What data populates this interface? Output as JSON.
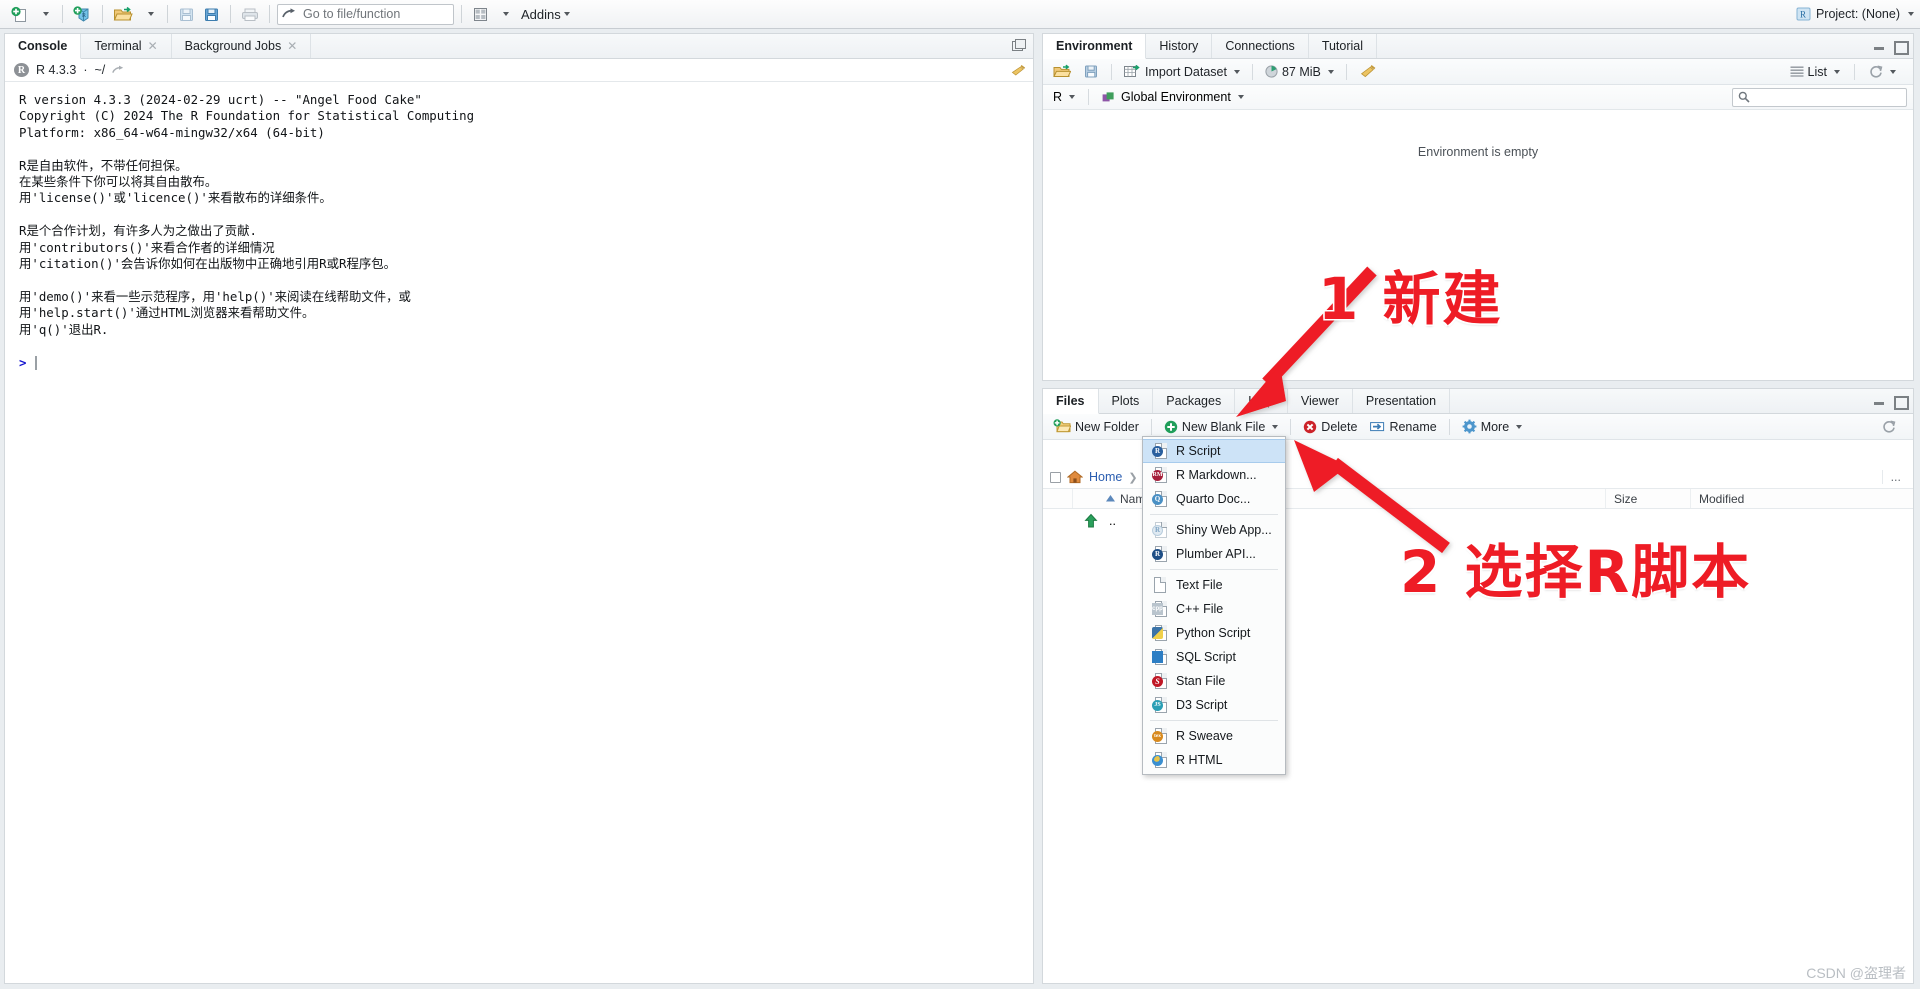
{
  "toolbar": {
    "new_file_label": "new-file",
    "new_project_label": "new-project",
    "open_file_label": "open-file",
    "save_label": "save",
    "save_all_label": "save-all",
    "print_label": "print",
    "goto_placeholder": "Go to file/function",
    "panes_label": "panes",
    "addins_label": "Addins",
    "project_label": "Project: (None)"
  },
  "console": {
    "tabs": [
      {
        "label": "Console",
        "closable": false,
        "active": true
      },
      {
        "label": "Terminal",
        "closable": true,
        "active": false
      },
      {
        "label": "Background Jobs",
        "closable": true,
        "active": false
      }
    ],
    "version_label": "R 4.3.3",
    "path_label": "~/",
    "separator": "·",
    "output": "R version 4.3.3 (2024-02-29 ucrt) -- \"Angel Food Cake\"\nCopyright (C) 2024 The R Foundation for Statistical Computing\nPlatform: x86_64-w64-mingw32/x64 (64-bit)\n\nR是自由软件，不带任何担保。\n在某些条件下你可以将其自由散布。\n用'license()'或'licence()'来看散布的详细条件。\n\nR是个合作计划，有许多人为之做出了贡献.\n用'contributors()'来看合作者的详细情况\n用'citation()'会告诉你如何在出版物中正确地引用R或R程序包。\n\n用'demo()'来看一些示范程序，用'help()'来阅读在线帮助文件，或\n用'help.start()'通过HTML浏览器来看帮助文件。\n用'q()'退出R.",
    "prompt": ">"
  },
  "environment": {
    "tabs": [
      {
        "label": "Environment",
        "active": true
      },
      {
        "label": "History",
        "active": false
      },
      {
        "label": "Connections",
        "active": false
      },
      {
        "label": "Tutorial",
        "active": false
      }
    ],
    "toolbar": {
      "load_label": "load-workspace",
      "save_label": "save-workspace",
      "import_label": "Import Dataset",
      "memory_label": "87 MiB",
      "clear_label": "clear-objects",
      "view_label": "List",
      "refresh_label": "refresh"
    },
    "language_label": "R",
    "scope_label": "Global Environment",
    "search_placeholder": "",
    "empty_message": "Environment is empty"
  },
  "files": {
    "tabs": [
      {
        "label": "Files",
        "active": true
      },
      {
        "label": "Plots",
        "active": false
      },
      {
        "label": "Packages",
        "active": false
      },
      {
        "label": "Help",
        "active": false
      },
      {
        "label": "Viewer",
        "active": false
      },
      {
        "label": "Presentation",
        "active": false
      }
    ],
    "toolbar": {
      "new_folder_label": "New Folder",
      "new_blank_file_label": "New Blank File",
      "delete_label": "Delete",
      "rename_label": "Rename",
      "more_label": "More",
      "refresh_label": "refresh"
    },
    "breadcrumb": [
      "Home"
    ],
    "more_button_label": "...",
    "columns": [
      "",
      "Name",
      "Size",
      "Modified"
    ],
    "rows": [
      {
        "name": "..",
        "size": "",
        "modified": ""
      }
    ]
  },
  "new_file_menu": {
    "items": [
      {
        "label": "R Script",
        "icon": "r-script-icon",
        "selected": true,
        "sep_after": false
      },
      {
        "label": "R Markdown...",
        "icon": "r-markdown-icon",
        "selected": false,
        "sep_after": false
      },
      {
        "label": "Quarto Doc...",
        "icon": "quarto-icon",
        "selected": false,
        "sep_after": true
      },
      {
        "label": "Shiny Web App...",
        "icon": "shiny-icon",
        "selected": false,
        "sep_after": false
      },
      {
        "label": "Plumber API...",
        "icon": "plumber-icon",
        "selected": false,
        "sep_after": true
      },
      {
        "label": "Text File",
        "icon": "text-file-icon",
        "selected": false,
        "sep_after": false
      },
      {
        "label": "C++ File",
        "icon": "cpp-file-icon",
        "selected": false,
        "sep_after": false
      },
      {
        "label": "Python Script",
        "icon": "python-icon",
        "selected": false,
        "sep_after": false
      },
      {
        "label": "SQL Script",
        "icon": "sql-icon",
        "selected": false,
        "sep_after": false
      },
      {
        "label": "Stan File",
        "icon": "stan-icon",
        "selected": false,
        "sep_after": false
      },
      {
        "label": "D3 Script",
        "icon": "d3-icon",
        "selected": false,
        "sep_after": true
      },
      {
        "label": "R Sweave",
        "icon": "sweave-icon",
        "selected": false,
        "sep_after": false
      },
      {
        "label": "R HTML",
        "icon": "rhtml-icon",
        "selected": false,
        "sep_after": false
      }
    ]
  },
  "annotations": [
    {
      "id": "step1",
      "text": "1 新建",
      "color": "#ee1c25"
    },
    {
      "id": "step2",
      "text": "2 选择R脚本",
      "color": "#ee1c25"
    }
  ],
  "watermark": "CSDN @盗理者",
  "colors": {
    "accent_red": "#ee1c25",
    "link_blue": "#2a5db0",
    "pane_border": "#d3d8dc",
    "menu_select": "#cde3f7"
  }
}
